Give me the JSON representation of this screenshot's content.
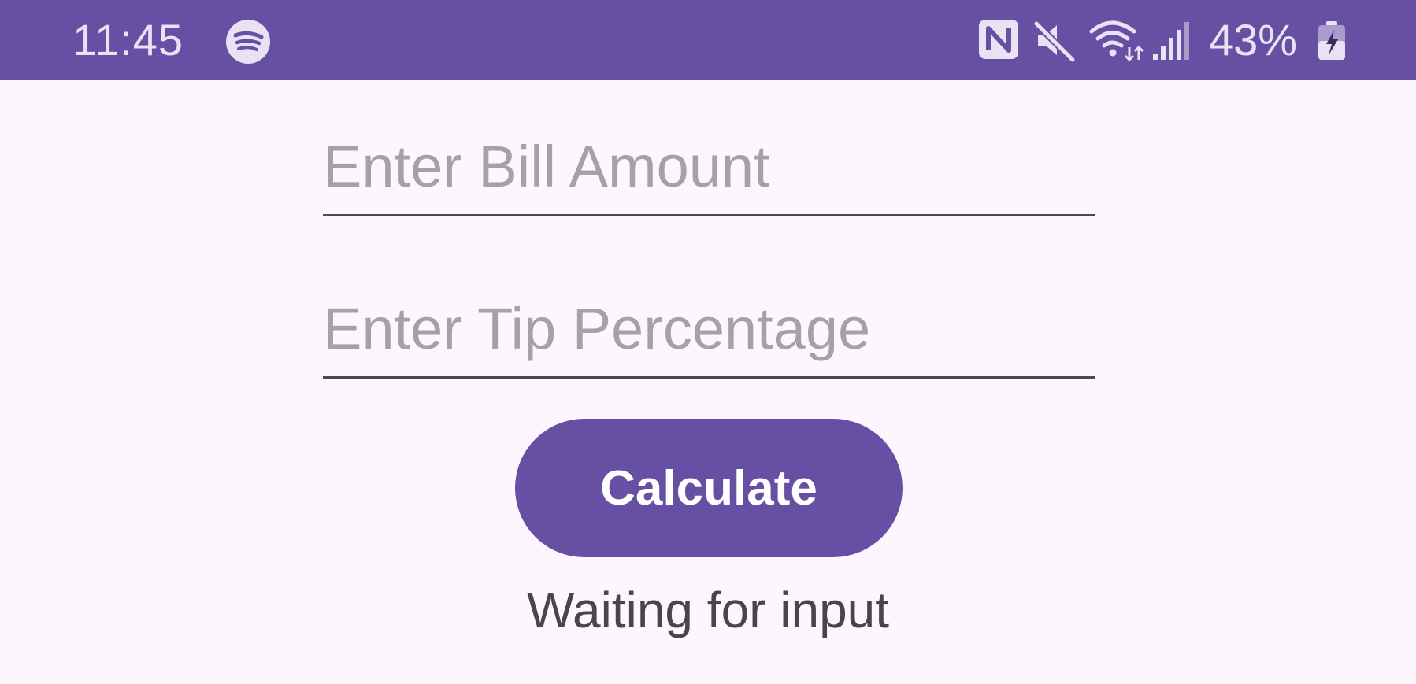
{
  "status_bar": {
    "time": "11:45",
    "battery_percent": "43%",
    "background_color": "#6750a4",
    "icons": [
      "spotify-icon",
      "nfc-icon",
      "mute-icon",
      "wifi-icon",
      "signal-icon",
      "battery-charging-icon"
    ]
  },
  "form": {
    "bill_amount": {
      "value": "",
      "placeholder": "Enter Bill Amount"
    },
    "tip_percentage": {
      "value": "",
      "placeholder": "Enter Tip Percentage"
    },
    "calculate_label": "Calculate",
    "result_text": "Waiting for input"
  },
  "colors": {
    "accent": "#6750a4",
    "background": "#fef6fe",
    "placeholder": "#a7a0a9",
    "text": "#49454f"
  }
}
